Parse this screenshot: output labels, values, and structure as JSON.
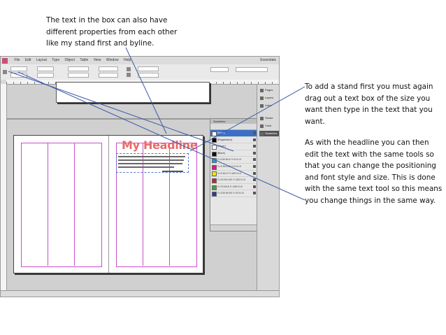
{
  "annotations": {
    "top_note": "The text in the box can also have different properties from each other like my stand first and byline.",
    "right_note_1": "To add a stand first you must again drag out a text box of the size you want then type in the text that you want.",
    "right_note_2": "As with the headline you can then edit the text with the same tools so that you can change the positioning and font style and size. This is done with the same text tool so this means you change things in the same way."
  },
  "menubar": {
    "items": [
      "File",
      "Edit",
      "Layout",
      "Type",
      "Object",
      "Table",
      "View",
      "Window",
      "Help"
    ],
    "workspace": "Essentials"
  },
  "document": {
    "headline": "My Headline"
  },
  "swatches_panel": {
    "title": "Swatches",
    "rows": [
      {
        "name": "[None]",
        "color": "#ffffff",
        "selected": true
      },
      {
        "name": "[Registration]",
        "color": "#000000"
      },
      {
        "name": "[Paper]",
        "color": "#ffffff"
      },
      {
        "name": "[Black]",
        "color": "#111111"
      },
      {
        "name": "C=100 M=0 Y=0 K=0",
        "color": "#19a0d8"
      },
      {
        "name": "C=0 M=100 Y=0 K=0",
        "color": "#d81b8a"
      },
      {
        "name": "C=0 M=0 Y=100 K=0",
        "color": "#f2e600"
      },
      {
        "name": "C=15 M=100 Y=100 K=0",
        "color": "#c8242b"
      },
      {
        "name": "C=75 M=5 Y=100 K=0",
        "color": "#3fa535"
      },
      {
        "name": "C=100 M=90 Y=10 K=0",
        "color": "#2c3b8f"
      }
    ]
  },
  "dock": {
    "items": [
      "Pages",
      "Layers",
      "Links",
      "Stroke",
      "Color",
      "Swatches"
    ]
  }
}
